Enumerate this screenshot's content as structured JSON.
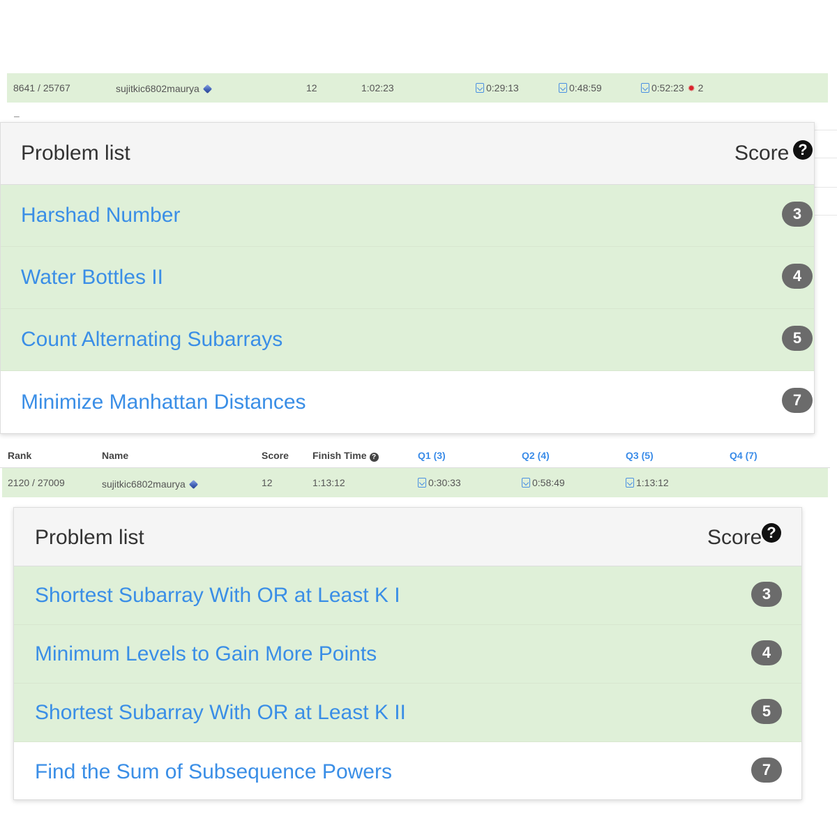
{
  "top_strip": {
    "rank": "8641 / 25767",
    "name": "sujitkic6802maurya",
    "score": "12",
    "finish_time": "1:02:23",
    "q1": "0:29:13",
    "q2": "0:48:59",
    "q3": "0:52:23",
    "q3_bugs": "2"
  },
  "top_card": {
    "title": "Problem list",
    "score_label": "Score",
    "help": "?",
    "problems": [
      {
        "name": "Harshad Number",
        "score": "3",
        "solved": true
      },
      {
        "name": "Water Bottles II",
        "score": "4",
        "solved": true
      },
      {
        "name": "Count Alternating Subarrays",
        "score": "5",
        "solved": true
      },
      {
        "name": "Minimize Manhattan Distances",
        "score": "7",
        "solved": false
      }
    ]
  },
  "ranking_header": {
    "rank": "Rank",
    "name": "Name",
    "score": "Score",
    "finish_time": "Finish Time",
    "help": "?",
    "q1": "Q1 (3)",
    "q2": "Q2 (4)",
    "q3": "Q3 (5)",
    "q4": "Q4 (7)"
  },
  "bottom_strip": {
    "rank": "2120 / 27009",
    "name": "sujitkic6802maurya",
    "score": "12",
    "finish_time": "1:13:12",
    "q1": "0:30:33",
    "q2": "0:58:49",
    "q3": "1:13:12"
  },
  "bottom_card": {
    "title": "Problem list",
    "score_label": "Score",
    "help": "?",
    "problems": [
      {
        "name": "Shortest Subarray With OR at Least K I",
        "score": "3",
        "solved": true
      },
      {
        "name": "Minimum Levels to Gain More Points",
        "score": "4",
        "solved": true
      },
      {
        "name": "Shortest Subarray With OR at Least K II",
        "score": "5",
        "solved": true
      },
      {
        "name": "Find the Sum of Subsequence Powers",
        "score": "7",
        "solved": false
      }
    ]
  },
  "colors": {
    "solved_bg": "#dff0d8",
    "link": "#3a8ee6",
    "badge": "#6b6b6b",
    "bug": "#d9232c"
  }
}
